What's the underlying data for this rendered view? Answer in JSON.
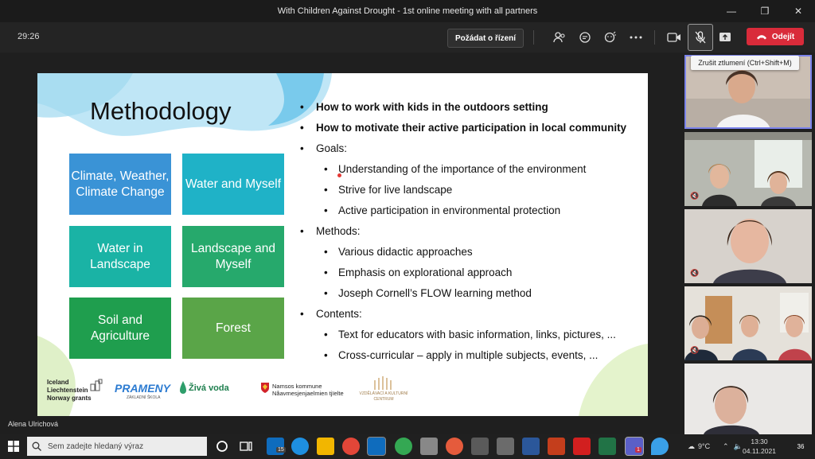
{
  "window": {
    "title": "With Children Against Drought - 1st online meeting with all partners"
  },
  "toolbar": {
    "timer": "29:26",
    "request_control_label": "Požádat o řízení",
    "leave_label": "Odejít",
    "mic_tooltip": "Zrušit ztlumení (Ctrl+Shift+M)"
  },
  "slide": {
    "title": "Methodology",
    "tiles": [
      {
        "label": "Climate, Weather, Climate Change",
        "color": "#3a93d6"
      },
      {
        "label": "Water and Myself",
        "color": "#1fb2c7"
      },
      {
        "label": "Water in Landscape",
        "color": "#1ab3a5"
      },
      {
        "label": "Landscape and Myself",
        "color": "#26a96c"
      },
      {
        "label": "Soil and Agriculture",
        "color": "#1f9e4e"
      },
      {
        "label": "Forest",
        "color": "#5aa548"
      }
    ],
    "bullets": [
      {
        "level": 1,
        "bold": true,
        "text": "How to work with kids in the outdoors setting"
      },
      {
        "level": 1,
        "bold": true,
        "text": "How to motivate their active participation in local community"
      },
      {
        "level": 1,
        "bold": false,
        "text": "Goals:"
      },
      {
        "level": 2,
        "bold": false,
        "text": "Understanding of the importance of the environment"
      },
      {
        "level": 2,
        "bold": false,
        "text": "Strive for live landscape"
      },
      {
        "level": 2,
        "bold": false,
        "text": "Active participation in environmental protection"
      },
      {
        "level": 1,
        "bold": false,
        "text": "Methods:"
      },
      {
        "level": 2,
        "bold": false,
        "text": "Various didactic approaches"
      },
      {
        "level": 2,
        "bold": false,
        "text": "Emphasis on explorational approach"
      },
      {
        "level": 2,
        "bold": false,
        "text": "Joseph Cornell’s FLOW learning method"
      },
      {
        "level": 1,
        "bold": false,
        "text": "Contents:"
      },
      {
        "level": 2,
        "bold": false,
        "text": "Text for educators with basic information, links, pictures, ..."
      },
      {
        "level": 2,
        "bold": false,
        "text": "Cross-curricular – apply in multiple subjects, events, ..."
      }
    ],
    "logos": {
      "iceland_lines": [
        "Iceland",
        "Liechtenstein",
        "Norway grants"
      ],
      "prameny": "PRAMENY",
      "prameny_sub": "ZÁKLADNÍ ŠKOLA",
      "ziva_voda": "Živá voda",
      "namsos_line1": "Namsos kommune",
      "namsos_line2": "Nåavmesjenjaelmien tjïelte",
      "centrum_lines": [
        "VZDĚLÁVACÍ A KULTURNÍ",
        "CENTRUM"
      ]
    }
  },
  "presenter_name": "Alena Ulrichová",
  "taskbar": {
    "search_placeholder": "Sem zadejte hledaný výraz",
    "mail_badge": "15",
    "teams_badge": "1",
    "temperature": "9°C",
    "time": "13:30",
    "date": "04.11.2021",
    "notifications": "36"
  },
  "colors": {
    "accent_teams": "#7b83eb",
    "leave_red": "#d92b3a"
  }
}
